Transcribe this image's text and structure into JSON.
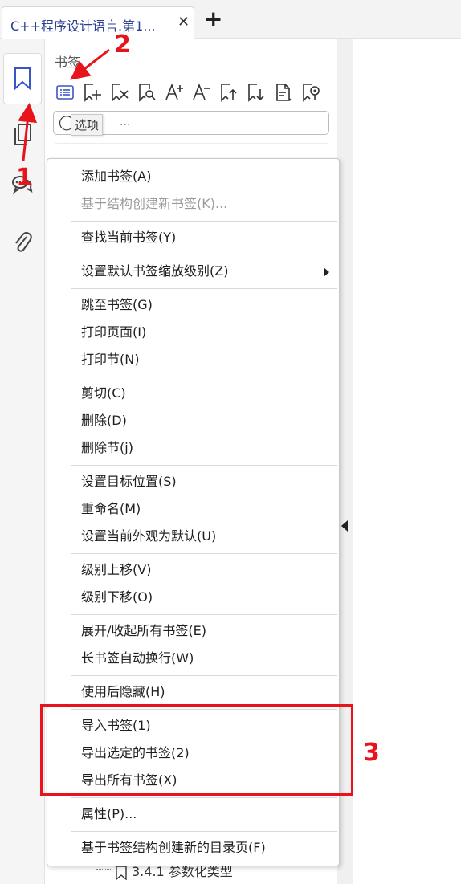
{
  "tab": {
    "title": "C++程序设计语言.第1...",
    "close": "✕",
    "add": "+"
  },
  "panel": {
    "title": "书签",
    "search_placeholder": "...",
    "tooltip": "选项",
    "tree_item": "3.4.1 参数化类型"
  },
  "rail": {
    "items": [
      {
        "icon": "bookmark-icon"
      },
      {
        "icon": "pages-icon"
      },
      {
        "icon": "comments-icon"
      },
      {
        "icon": "attachment-icon"
      }
    ]
  },
  "toolbar_icons": [
    "options-list-icon",
    "add-bookmark-icon",
    "delete-bookmark-icon",
    "find-bookmark-icon",
    "increase-font-icon",
    "decrease-font-icon",
    "move-up-icon",
    "move-down-icon",
    "bookmark-properties-icon",
    "bookmark-destination-icon"
  ],
  "menu": {
    "items": [
      "添加书签(A)",
      "基于结构创建新书签(K)...",
      "查找当前书签(Y)",
      "设置默认书签缩放级别(Z)",
      "跳至书签(G)",
      "打印页面(I)",
      "打印节(N)",
      "剪切(C)",
      "删除(D)",
      "删除节(j)",
      "设置目标位置(S)",
      "重命名(M)",
      "设置当前外观为默认(U)",
      "级别上移(V)",
      "级别下移(O)",
      "展开/收起所有书签(E)",
      "长书签自动换行(W)",
      "使用后隐藏(H)",
      "导入书签(1)",
      "导出选定的书签(2)",
      "导出所有书签(X)",
      "属性(P)...",
      "基于书签结构创建新的目录页(F)"
    ]
  },
  "annotations": {
    "one": "1",
    "two": "2",
    "three": "3"
  },
  "colors": {
    "accent": "#3b56c4",
    "annotation": "#e8141b"
  }
}
